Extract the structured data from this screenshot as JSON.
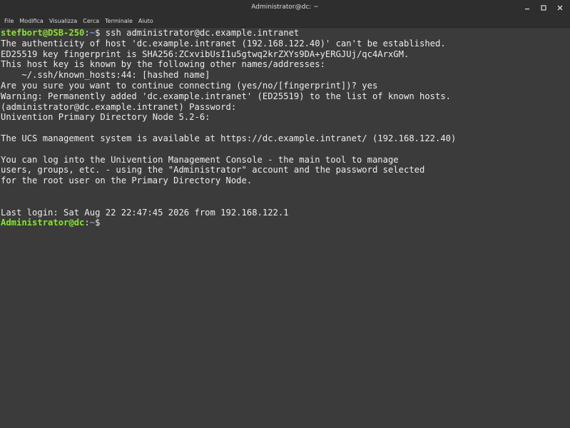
{
  "window": {
    "title": "Administrator@dc: ~",
    "controls": {
      "minimize_icon": "minimize-icon",
      "maximize_icon": "maximize-icon",
      "close_icon": "close-icon"
    }
  },
  "menubar": {
    "items": [
      "File",
      "Modifica",
      "Visualizza",
      "Cerca",
      "Terminale",
      "Aiuto"
    ]
  },
  "colors": {
    "prompt_user": "#8ae234",
    "prompt_path": "#729fcf",
    "terminal_bg": "#3b3b3b",
    "terminal_fg": "#ededed"
  },
  "terminal": {
    "first_prompt": {
      "user": "stefbort@DSB-250",
      "sep": ":",
      "path": "~",
      "symbol": "$",
      "command": " ssh administrator@dc.example.intranet"
    },
    "output": [
      "The authenticity of host 'dc.example.intranet (192.168.122.40)' can't be established.",
      "ED25519 key fingerprint is SHA256:ZCxvibUsI1u5gtwq2krZXYs9DA+yERGJUj/qc4ArxGM.",
      "This host key is known by the following other names/addresses:",
      "    ~/.ssh/known_hosts:44: [hashed name]",
      "Are you sure you want to continue connecting (yes/no/[fingerprint])? yes",
      "Warning: Permanently added 'dc.example.intranet' (ED25519) to the list of known hosts.",
      "(administrator@dc.example.intranet) Password:",
      "Univention Primary Directory Node 5.2-6:",
      "",
      "The UCS management system is available at https://dc.example.intranet/ (192.168.122.40)",
      "",
      "You can log into the Univention Management Console - the main tool to manage",
      "users, groups, etc. - using the \"Administrator\" account and the password selected",
      "for the root user on the Primary Directory Node.",
      "",
      "",
      "Last login: Sat Aug 22 22:47:45 2026 from 192.168.122.1"
    ],
    "second_prompt": {
      "user": "Administrator@dc",
      "sep": ":",
      "path": "~",
      "symbol": "$",
      "command": ""
    }
  }
}
